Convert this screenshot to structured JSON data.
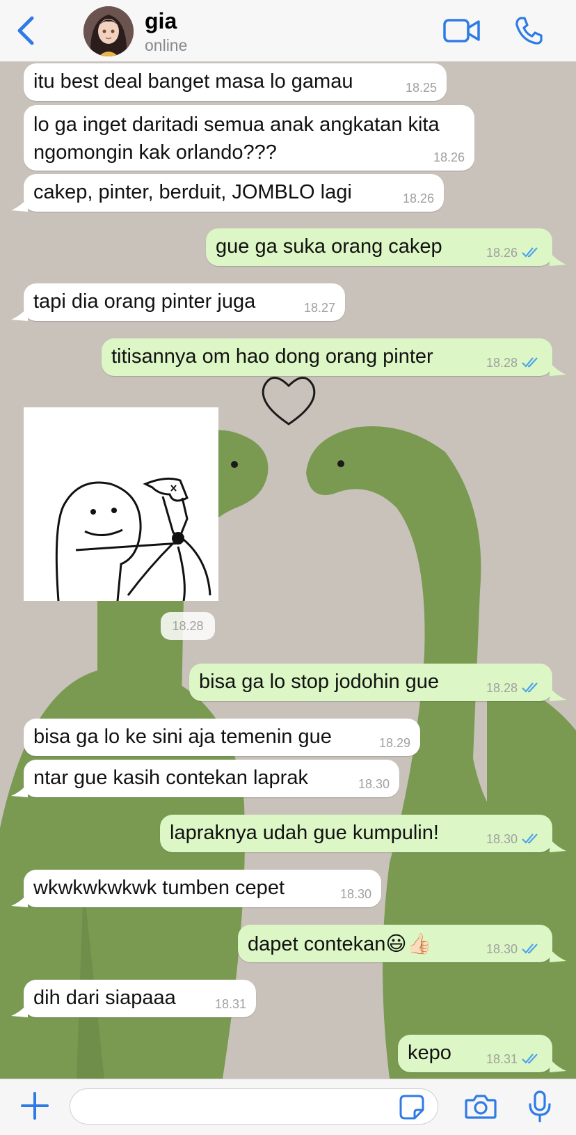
{
  "header": {
    "contact_name": "gia",
    "contact_status": "online"
  },
  "colors": {
    "accent": "#2f7be6",
    "incoming_bubble": "#ffffff",
    "outgoing_bubble": "#dcf7c5",
    "read_ticks": "#4fa3e8"
  },
  "messages": [
    {
      "dir": "in",
      "text": "itu best deal banget masa lo gamau",
      "time": "18.25"
    },
    {
      "dir": "in",
      "text": "lo ga inget daritadi semua anak angkatan kita ngomongin kak orlando???",
      "time": "18.26"
    },
    {
      "dir": "in",
      "text": "cakep, pinter, berduit, JOMBLO lagi",
      "time": "18.26"
    },
    {
      "dir": "out",
      "text": "gue ga suka orang cakep",
      "time": "18.26"
    },
    {
      "dir": "in",
      "text": "tapi dia orang pinter juga",
      "time": "18.27"
    },
    {
      "dir": "out",
      "text": "titisannya om hao dong orang pinter",
      "time": "18.28"
    },
    {
      "dir": "in",
      "type": "sticker",
      "time": "18.28"
    },
    {
      "dir": "out",
      "text": "bisa ga lo stop jodohin gue",
      "time": "18.28"
    },
    {
      "dir": "in",
      "text": "bisa ga lo ke sini aja temenin gue",
      "time": "18.29"
    },
    {
      "dir": "in",
      "text": "ntar gue kasih contekan laprak",
      "time": "18.30"
    },
    {
      "dir": "out",
      "text": "lapraknya udah gue kumpulin!",
      "time": "18.30"
    },
    {
      "dir": "in",
      "text": "wkwkwkwkwk tumben cepet",
      "time": "18.30"
    },
    {
      "dir": "out",
      "text": "dapet contekan😃👍🏻",
      "time": "18.30"
    },
    {
      "dir": "in",
      "text": "dih dari siapaaa",
      "time": "18.31"
    },
    {
      "dir": "out",
      "text": "kepo",
      "time": "18.31"
    }
  ],
  "icons": {
    "back": "chevron-left-icon",
    "video": "video-camera-icon",
    "call": "phone-icon",
    "attach": "plus-icon",
    "sticker": "sticker-icon",
    "camera": "camera-icon",
    "mic": "microphone-icon"
  }
}
